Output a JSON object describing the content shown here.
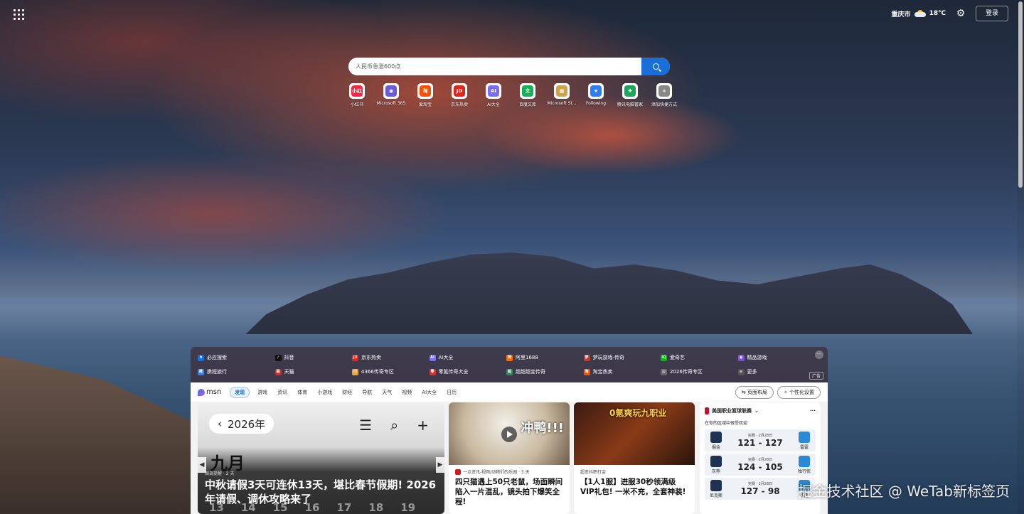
{
  "header": {
    "city": "重庆市",
    "temperature": "18℃",
    "login_label": "登录"
  },
  "search": {
    "placeholder": "人民币急涨600点"
  },
  "shortcuts": [
    {
      "label": "小红书",
      "icon_text": "小红",
      "color": "#ff2442"
    },
    {
      "label": "Microsoft 365",
      "icon_text": "◉",
      "color": "#6b5bd6"
    },
    {
      "label": "爱淘宝",
      "icon_text": "淘",
      "color": "#ff5000"
    },
    {
      "label": "京东热卖",
      "icon_text": "JD",
      "color": "#e1251b"
    },
    {
      "label": "AI大全",
      "icon_text": "AI",
      "color": "#7b6cf6"
    },
    {
      "label": "百度文库",
      "icon_text": "文",
      "color": "#16b055"
    },
    {
      "label": "Microsoft St...",
      "icon_text": "▦",
      "color": "#cfa34b"
    },
    {
      "label": "Following",
      "icon_text": "★",
      "color": "#2e7ef0"
    },
    {
      "label": "腾讯电脑管家",
      "icon_text": "✚",
      "color": "#1fa55a"
    },
    {
      "label": "添加快捷方式",
      "icon_text": "+",
      "color": "#888888"
    }
  ],
  "quick_links": [
    {
      "label": "必应搜索",
      "icon_text": "b",
      "color": "#1a6ed8"
    },
    {
      "label": "抖音",
      "icon_text": "♪",
      "color": "#111111"
    },
    {
      "label": "京东热卖",
      "icon_text": "JD",
      "color": "#e1251b"
    },
    {
      "label": "AI大全",
      "icon_text": "AI",
      "color": "#7b6cf6"
    },
    {
      "label": "阿里1688",
      "icon_text": "阿",
      "color": "#ff6a00"
    },
    {
      "label": "梦玩游戏-传奇",
      "icon_text": "梦",
      "color": "#c0392b"
    },
    {
      "label": "爱奇艺",
      "icon_text": "iQ",
      "color": "#00be06"
    },
    {
      "label": "精品游戏",
      "icon_text": "▣",
      "color": "#7b4fd6"
    },
    {
      "label": "携程旅行",
      "icon_text": "携",
      "color": "#2f80ed"
    },
    {
      "label": "天猫",
      "icon_text": "猫",
      "color": "#e1251b"
    },
    {
      "label": "4366传奇专区",
      "icon_text": "🐱",
      "color": "#f0a030"
    },
    {
      "label": "零氪传奇大全",
      "icon_text": "零",
      "color": "#d93030"
    },
    {
      "label": "超超超变传奇",
      "icon_text": "超",
      "color": "#2e8b57"
    },
    {
      "label": "淘宝热卖",
      "icon_text": "淘",
      "color": "#ff5000"
    },
    {
      "label": "2026传奇专区",
      "icon_text": "▤",
      "color": "#666666"
    },
    {
      "label": "更多",
      "icon_text": "≡",
      "color": "#555555"
    }
  ],
  "ad_label": "广告",
  "feed": {
    "logo": "msn",
    "tabs": [
      "发现",
      "游戏",
      "资讯",
      "体育",
      "小游戏",
      "财经",
      "导航",
      "天气",
      "视频",
      "AI大全",
      "日历"
    ],
    "layout_button": "页面布局",
    "personalize_button": "个性化设置"
  },
  "calendar": {
    "year": "2026年",
    "month": "九月",
    "source": "调调提醒 · 2 天",
    "headline": "中秋请假3天可连休13天，堪比春节假期! 2026年请假、调休攻略来了",
    "days": [
      "13",
      "14",
      "15",
      "16",
      "17",
      "18",
      "19"
    ]
  },
  "cards": [
    {
      "source": "一点资讯-视频/动物们的乐园 · 3 天",
      "title": "四只猫遇上50只老鼠，场面瞬间陷入一片混乱，镜头拍下爆笑全程!",
      "overlay": "冲鸭!!!"
    },
    {
      "source": "超变抖职打金",
      "title": "【1人1服】进服30秒领满级VIP礼包! 一米不充，全套神装!",
      "overlay": "0氪爽玩九职业"
    }
  ],
  "nba": {
    "title": "美国职业篮球联赛",
    "subtitle": "在你的区域中很受欢迎",
    "games": [
      {
        "status": "完赛 · 2月28日",
        "home": "掘金",
        "score": "121 - 127",
        "away": "雷霆"
      },
      {
        "status": "完赛 · 2月28日",
        "home": "灰熊",
        "score": "124 - 105",
        "away": "独行侠"
      },
      {
        "status": "完赛 · 2月28日",
        "home": "尼克斯",
        "score": "127 - 98",
        "away": "雄鹿"
      }
    ]
  },
  "watermark": "掘金技术社区 @ WeTab新标签页"
}
